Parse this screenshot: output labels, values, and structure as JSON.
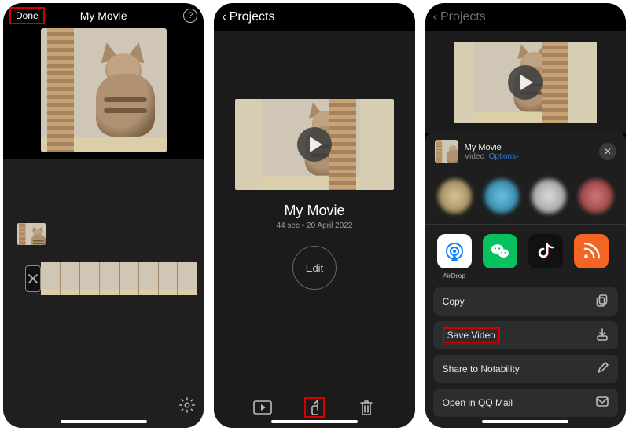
{
  "panel1": {
    "done": "Done",
    "title": "My Movie",
    "help": "?",
    "gear_icon": "gear"
  },
  "panel2": {
    "back": "Projects",
    "title": "My Movie",
    "meta": "44 sec • 20 April 2022",
    "edit": "Edit",
    "bottom": {
      "play": "play",
      "share": "share",
      "trash": "trash"
    }
  },
  "panel3": {
    "back": "Projects",
    "sheet": {
      "title": "My Movie",
      "type": "Video",
      "options": "Options",
      "chev": "›",
      "close": "✕",
      "apps": {
        "airdrop": "AirDrop",
        "wechat": "",
        "tiktok": "",
        "rss": ""
      },
      "actions": {
        "copy": "Copy",
        "save": "Save Video",
        "share_notability": "Share to Notability",
        "open_qqmail": "Open in QQ Mail"
      }
    }
  }
}
